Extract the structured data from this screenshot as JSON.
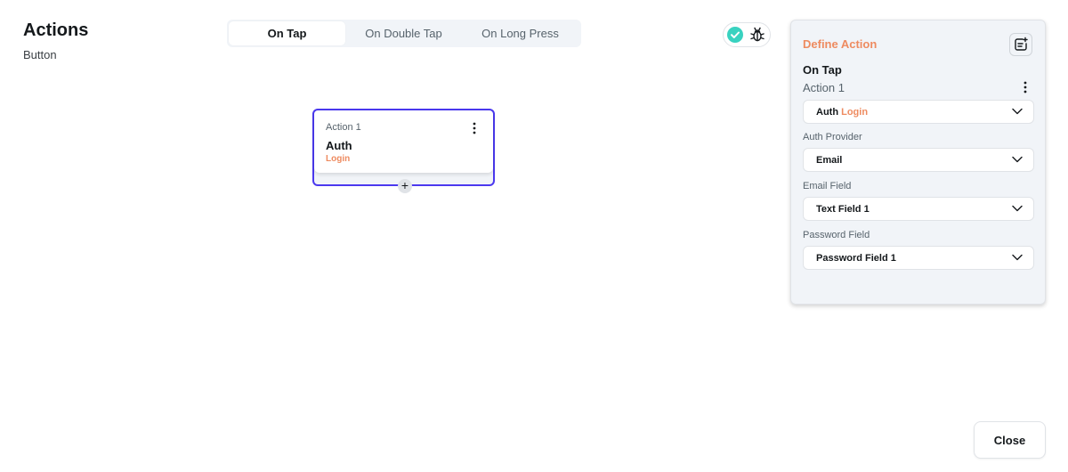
{
  "header": {
    "title": "Actions",
    "subtitle": "Button"
  },
  "tabs": [
    {
      "label": "On Tap",
      "active": true
    },
    {
      "label": "On Double Tap",
      "active": false
    },
    {
      "label": "On Long Press",
      "active": false
    }
  ],
  "icons": {
    "status": "check-circle-icon",
    "debug": "bug-icon",
    "menu": "more-vertical-icon",
    "add": "plus-icon",
    "panel": "add-note-icon"
  },
  "action_card": {
    "label": "Action 1",
    "type": "Auth",
    "subtype": "Login",
    "add_symbol": "+"
  },
  "panel": {
    "title": "Define Action",
    "trigger": "On Tap",
    "action_name": "Action 1",
    "action_type": {
      "main": "Auth",
      "accent": "Login"
    },
    "fields": [
      {
        "label": "Auth Provider",
        "value": "Email"
      },
      {
        "label": "Email Field",
        "value": "Text Field 1"
      },
      {
        "label": "Password Field",
        "value": "Password Field 1"
      }
    ]
  },
  "footer": {
    "close_label": "Close"
  },
  "colors": {
    "primary": "#4b39ef",
    "accent": "#ee8b60",
    "success": "#39d2c0",
    "panel_bg": "#f1f4f8"
  }
}
